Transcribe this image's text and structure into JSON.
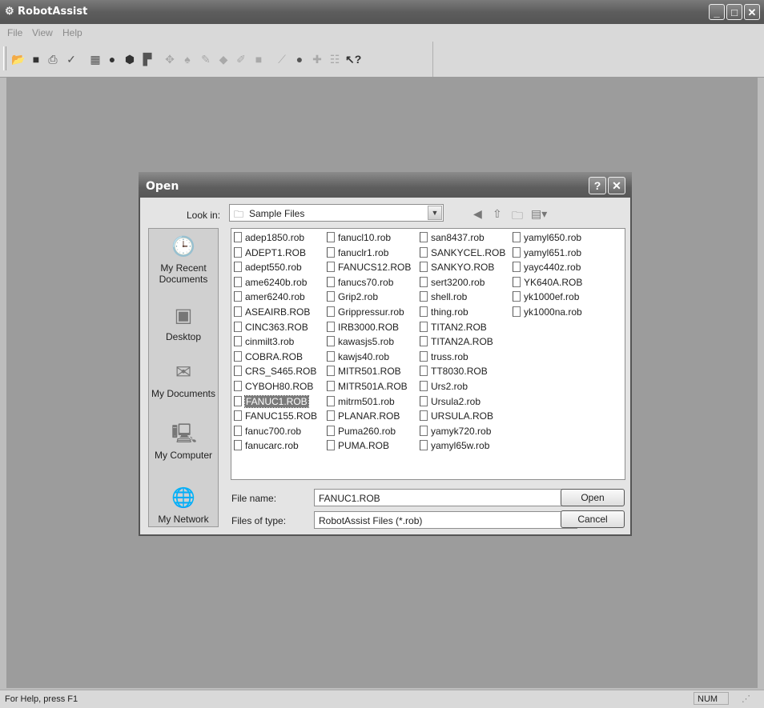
{
  "window": {
    "title": "RobotAssist",
    "controls": [
      "minimize-icon",
      "maximize-icon",
      "close-icon"
    ]
  },
  "menu": [
    "File",
    "View",
    "Help"
  ],
  "toolbar_icons": [
    "open-icon",
    "save-icon",
    "print-icon",
    "check-icon",
    "grid-icon",
    "record-icon",
    "stop-icon",
    "tool-icon",
    "move-icon",
    "joint-icon",
    "pen-icon",
    "point-icon",
    "path-icon",
    "block-icon",
    "arm-icon",
    "circle-icon",
    "plus-path-icon",
    "teach-icon",
    "help-pointer-icon"
  ],
  "status": {
    "help": "For Help, press F1",
    "num": "NUM"
  },
  "dialog": {
    "title": "Open",
    "look_in_label": "Look in:",
    "look_in_value": "Sample Files",
    "places": [
      "My Recent\nDocuments",
      "Desktop",
      "My Documents",
      "My Computer",
      "My Network"
    ],
    "columns": [
      [
        "adep1850.rob",
        "ADEPT1.ROB",
        "adept550.rob",
        "ame6240b.rob",
        "amer6240.rob",
        "ASEAIRB.ROB",
        "CINC363.ROB",
        "cinmilt3.rob",
        "COBRA.ROB",
        "CRS_S465.ROB",
        "CYBOH80.ROB",
        "FANUC1.ROB",
        "FANUC155.ROB",
        "fanuc700.rob",
        "fanucarc.rob"
      ],
      [
        "fanucl10.rob",
        "fanuclr1.rob",
        "FANUCS12.ROB",
        "fanucs70.rob",
        "Grip2.rob",
        "Grippressur.rob",
        "IRB3000.ROB",
        "kawasjs5.rob",
        "kawjs40.rob",
        "MITR501.ROB",
        "MITR501A.ROB",
        "mitrm501.rob",
        "PLANAR.ROB",
        "Puma260.rob",
        "PUMA.ROB"
      ],
      [
        "san8437.rob",
        "SANKYCEL.ROB",
        "SANKYO.ROB",
        "sert3200.rob",
        "shell.rob",
        "thing.rob",
        "TITAN2.ROB",
        "TITAN2A.ROB",
        "truss.rob",
        "TT8030.ROB",
        "Urs2.rob",
        "Ursula2.rob",
        "URSULA.ROB",
        "yamyk720.rob",
        "yamyl65w.rob"
      ],
      [
        "yamyl650.rob",
        "yamyl651.rob",
        "yayc440z.rob",
        "YK640A.ROB",
        "yk1000ef.rob",
        "yk1000na.rob"
      ]
    ],
    "selected_file": "FANUC1.ROB",
    "file_name_label": "File name:",
    "file_name_value": "FANUC1.ROB",
    "file_type_label": "Files of type:",
    "file_type_value": "RobotAssist Files (*.rob)",
    "open_label": "Open",
    "cancel_label": "Cancel"
  }
}
